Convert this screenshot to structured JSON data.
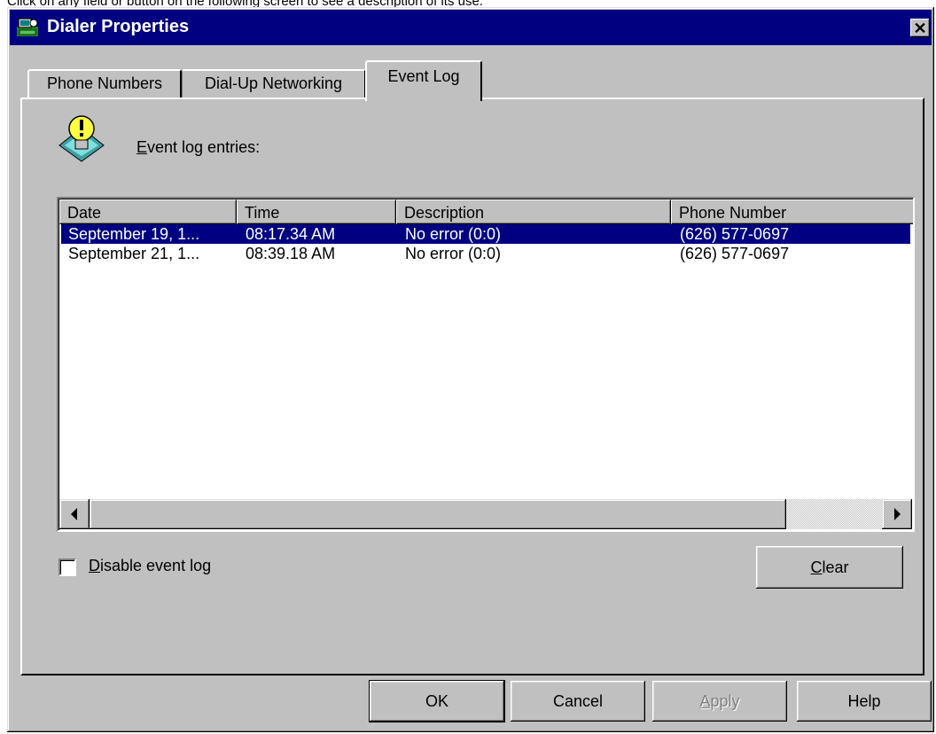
{
  "caption": "Click on any field or button on the following screen to see a description of its use.",
  "window": {
    "title": "Dialer Properties",
    "close_label": "✕"
  },
  "tabs": [
    {
      "label": "Phone Numbers",
      "active": false
    },
    {
      "label": "Dial-Up Networking",
      "active": false
    },
    {
      "label": "Event Log",
      "active": true
    }
  ],
  "event_log": {
    "label_mnemonic": "E",
    "label_rest": "vent log entries:",
    "columns": [
      "Date",
      "Time",
      "Description",
      "Phone Number"
    ],
    "rows": [
      {
        "date": "September 19, 1...",
        "time": "08:17.34 AM",
        "description": "No error (0:0)",
        "phone": "(626) 577-0697",
        "selected": true
      },
      {
        "date": "September 21, 1...",
        "time": "08:39.18 AM",
        "description": "No error (0:0)",
        "phone": "(626) 577-0697",
        "selected": false
      }
    ]
  },
  "disable_log": {
    "mnemonic": "D",
    "rest": "isable event log",
    "checked": false
  },
  "buttons": {
    "clear_mnemonic": "C",
    "clear_rest": "lear",
    "ok": "OK",
    "cancel": "Cancel",
    "apply_mnemonic": "A",
    "apply_rest": "pply",
    "help": "Help"
  },
  "icons": {
    "app": "dialer-app-icon",
    "warning": "lightbulb-warning-icon",
    "scroll_left": "arrow-left-icon",
    "scroll_right": "arrow-right-icon"
  },
  "colors": {
    "titlebar": "#000080",
    "face": "#c0c0c0",
    "selection": "#000080"
  }
}
